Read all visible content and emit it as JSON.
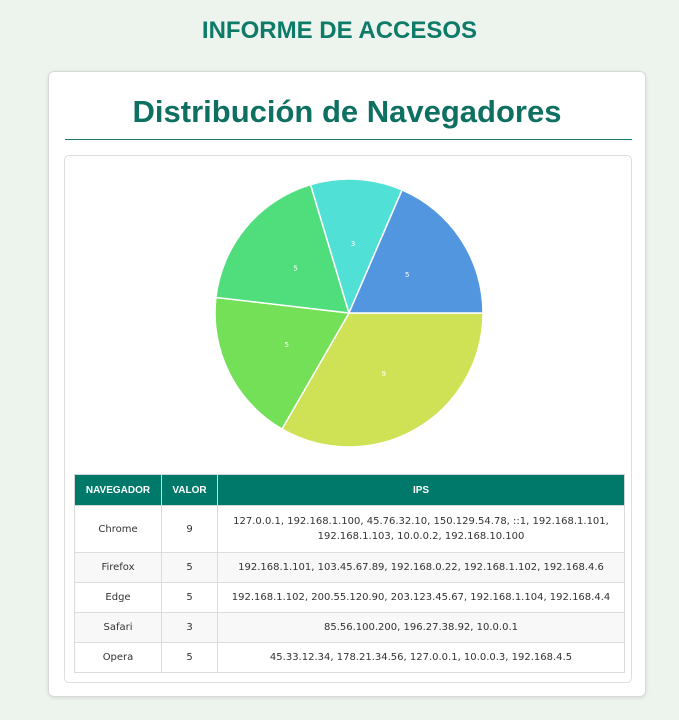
{
  "header": {
    "title": "INFORME DE ACCESOS"
  },
  "card": {
    "title": "Distribución de Navegadores"
  },
  "chart_data": {
    "type": "pie",
    "title": "Distribución de Navegadores",
    "categories": [
      "Chrome",
      "Firefox",
      "Edge",
      "Safari",
      "Opera"
    ],
    "values": [
      9,
      5,
      5,
      3,
      5
    ],
    "colors": [
      "#cfe255",
      "#74e057",
      "#50de7d",
      "#51e0d5",
      "#5396e0"
    ],
    "slice_order": [
      "Chrome",
      "Firefox",
      "Edge",
      "Safari",
      "Opera"
    ],
    "start_direction": "east, clockwise"
  },
  "table": {
    "headers": [
      "NAVEGADOR",
      "VALOR",
      "IPS"
    ],
    "rows": [
      {
        "navegador": "Chrome",
        "valor": "9",
        "ips": "127.0.0.1, 192.168.1.100, 45.76.32.10, 150.129.54.78, ::1, 192.168.1.101, 192.168.1.103, 10.0.0.2, 192.168.10.100"
      },
      {
        "navegador": "Firefox",
        "valor": "5",
        "ips": "192.168.1.101, 103.45.67.89, 192.168.0.22, 192.168.1.102, 192.168.4.6"
      },
      {
        "navegador": "Edge",
        "valor": "5",
        "ips": "192.168.1.102, 200.55.120.90, 203.123.45.67, 192.168.1.104, 192.168.4.4"
      },
      {
        "navegador": "Safari",
        "valor": "3",
        "ips": "85.56.100.200, 196.27.38.92, 10.0.0.1"
      },
      {
        "navegador": "Opera",
        "valor": "5",
        "ips": "45.33.12.34, 178.21.34.56, 127.0.0.1, 10.0.0.3, 192.168.4.5"
      }
    ]
  }
}
